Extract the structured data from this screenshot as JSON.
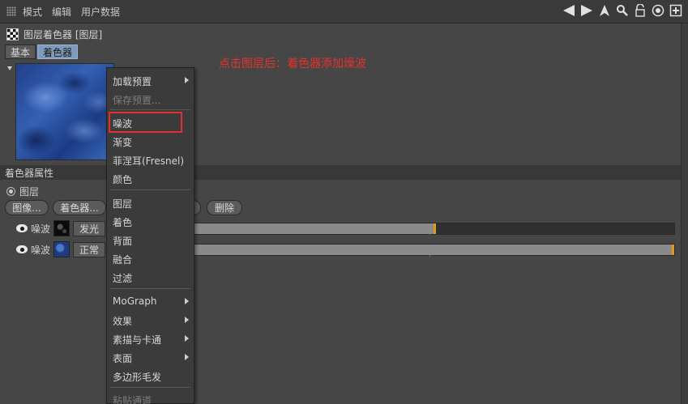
{
  "menubar": {
    "items": [
      "模式",
      "编辑",
      "用户数据"
    ]
  },
  "toolbar_icons": [
    "arrow-left-icon",
    "arrow-right-icon",
    "pointer-up-icon",
    "search-icon",
    "lock-icon",
    "target-icon",
    "new-window-icon"
  ],
  "title": "图层着色器 [图层]",
  "tabs": {
    "basic": "基本",
    "shader": "着色器"
  },
  "annotation": "点击图层后：着色器添加燥波",
  "section": {
    "attributes": "着色器属性",
    "layer_radio": "图层"
  },
  "buttons": {
    "image": "图像...",
    "shader": "着色器...",
    "delete": "删除"
  },
  "layers": [
    {
      "name": "噪波",
      "blend": "发光",
      "opacity_fraction": 0.5
    },
    {
      "name": "噪波",
      "blend": "正常",
      "opacity_fraction": 1.0
    }
  ],
  "context_menu": {
    "load_preset": "加载预置",
    "save_preset": "保存预置...",
    "noise": "噪波",
    "gradient": "渐变",
    "fresnel": "菲涅耳(Fresnel)",
    "color": "颜色",
    "layer": "图层",
    "colorize": "着色",
    "backdrop": "背面",
    "fusion": "融合",
    "filter": "过滤",
    "mograph": "MoGraph",
    "effects": "效果",
    "sketch_toon": "素描与卡通",
    "surfaces": "表面",
    "hair": "多边形毛发",
    "paste_channel": "粘贴通道"
  },
  "colors": {
    "accent_highlight": "#e03030",
    "annotation": "#e8312a",
    "slider_handle": "#e09a1a",
    "active_tab": "#7e9bbd"
  }
}
